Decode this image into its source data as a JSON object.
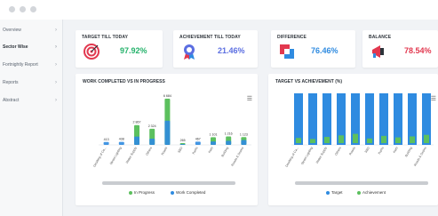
{
  "sidebar": {
    "items": [
      {
        "label": "Overview"
      },
      {
        "label": "Sector Wise"
      },
      {
        "label": "Fortnightly Report"
      },
      {
        "label": "Reports"
      },
      {
        "label": "Abstract"
      }
    ]
  },
  "cards": [
    {
      "label": "TARGET TILL TODAY",
      "value": "97.92%",
      "color": "#25b26b",
      "icon": "target-icon"
    },
    {
      "label": "ACHIEVEMENT TILL TODAY",
      "value": "21.46%",
      "color": "#5b6ee1",
      "icon": "medal-icon"
    },
    {
      "label": "DIFFERENCE",
      "value": "76.46%",
      "color": "#2f8be0",
      "icon": "difference-icon"
    },
    {
      "label": "BALANCE",
      "value": "78.54%",
      "color": "#e2384f",
      "icon": "megaphone-icon"
    }
  ],
  "work_panel": {
    "title": "WORK COMPLETED VS IN PROGRESS",
    "legend": [
      "In Progress",
      "Work Completed"
    ]
  },
  "target_panel": {
    "title": "TARGET VS ACHIEVEMENT (%)",
    "legend": [
      "Target",
      "Achievement"
    ]
  },
  "colors": {
    "green": "#5cc05e",
    "blue": "#2f8be0",
    "red": "#e2384f",
    "lightgray": "#c9ccd0"
  },
  "chart_data": [
    {
      "type": "bar",
      "title": "WORK COMPLETED VS IN PROGRESS",
      "categories": [
        "Desilting of Ca...",
        "Street Lighting",
        "Water Supply",
        "Others",
        "Roads",
        "SBD",
        "Parks",
        "Kerb",
        "Building",
        "Roads & Drains"
      ],
      "value_labels": [
        "413",
        "438",
        "2 867",
        "2 324",
        "6 684",
        "265",
        "467",
        "1 101",
        "1 216",
        "1 123"
      ],
      "series": [
        {
          "name": "In Progress",
          "values": [
            0,
            0,
            2867,
            2324,
            6684,
            265,
            0,
            1101,
            1216,
            1123
          ]
        },
        {
          "name": "Work Completed",
          "values": [
            413,
            438,
            1200,
            900,
            3500,
            120,
            467,
            500,
            600,
            700
          ]
        }
      ]
    },
    {
      "type": "bar",
      "title": "TARGET VS ACHIEVEMENT (%)",
      "categories": [
        "Desilting of Ca...",
        "Street Lighting",
        "Water Supply",
        "Others",
        "Roads",
        "SBD",
        "Parks",
        "Kerb",
        "Building",
        "Roads & Drains"
      ],
      "series": [
        {
          "name": "Target",
          "values": [
            100,
            100,
            100,
            100,
            100,
            100,
            100,
            100,
            100,
            100
          ]
        },
        {
          "name": "Achievement",
          "values": [
            10,
            8,
            12,
            15,
            18,
            9,
            14,
            11,
            13,
            16
          ]
        }
      ],
      "ylim": [
        0,
        100
      ]
    }
  ]
}
